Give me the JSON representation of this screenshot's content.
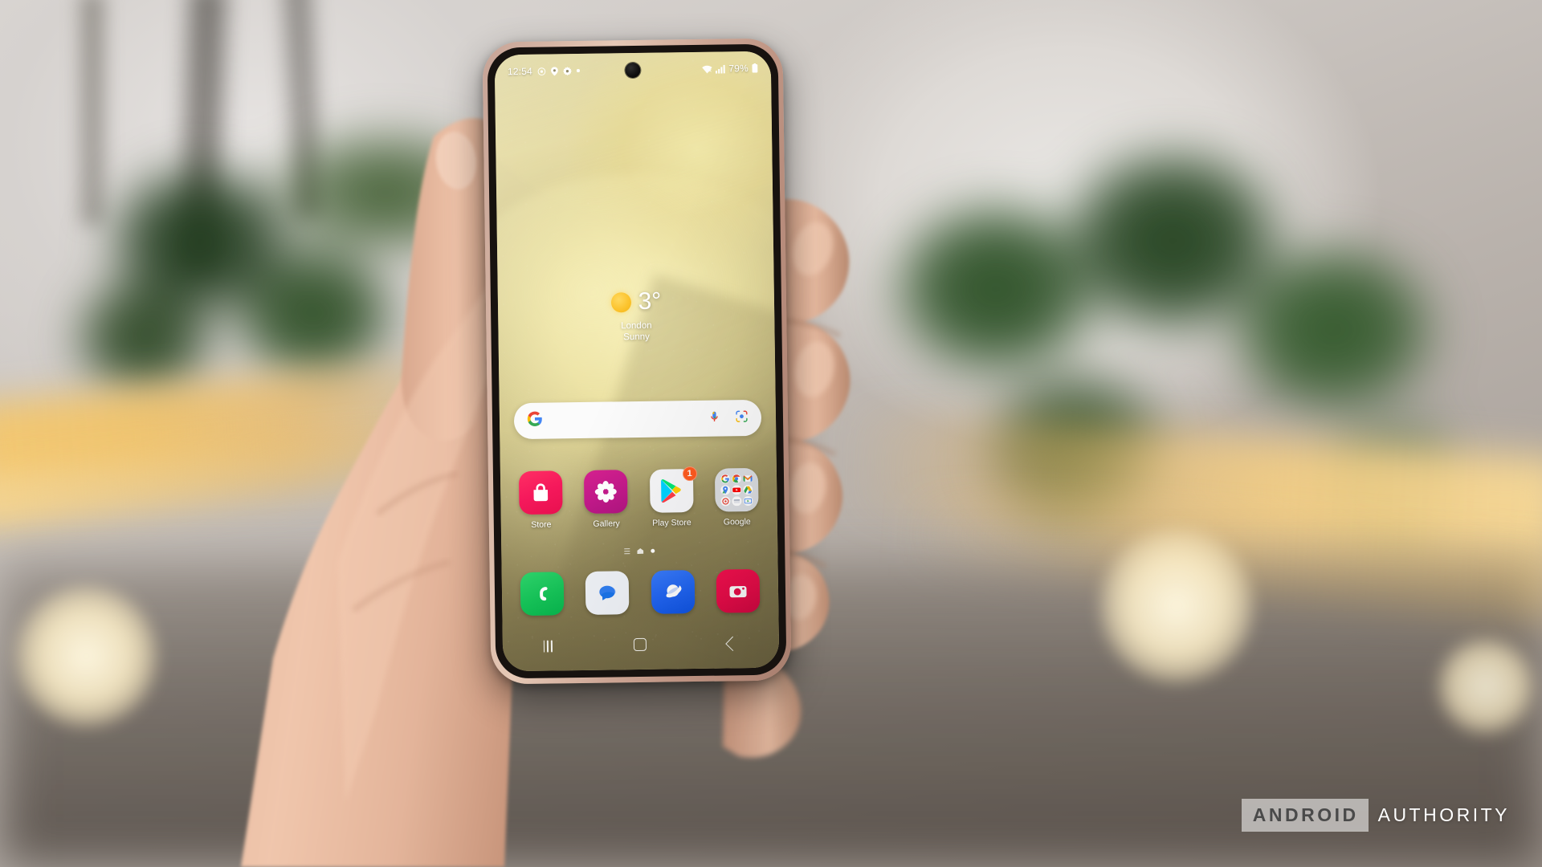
{
  "scene": {
    "watermark": {
      "brand": "ANDROID",
      "suffix": "AUTHORITY"
    }
  },
  "phone": {
    "status_bar": {
      "clock": "12:54",
      "left_icons": [
        "target-icon",
        "location-pin-icon",
        "settings-gear-icon",
        "dot-indicator"
      ],
      "right_icons": [
        "wifi-icon",
        "cellular-signal-icon"
      ],
      "battery_percent": "79%",
      "battery_icon": "battery-icon"
    },
    "weather_widget": {
      "temperature": "3°",
      "city": "London",
      "condition": "Sunny",
      "icon": "sun-icon"
    },
    "search_bar": {
      "logo": "google-g-icon",
      "placeholder": "",
      "value": "",
      "mic_icon": "microphone-icon",
      "lens_icon": "google-lens-icon"
    },
    "app_grid": [
      {
        "label": "Store",
        "icon": "galaxy-store-icon",
        "badge": ""
      },
      {
        "label": "Gallery",
        "icon": "gallery-icon",
        "badge": ""
      },
      {
        "label": "Play Store",
        "icon": "google-play-store-icon",
        "badge": "1"
      },
      {
        "label": "Google",
        "icon": "google-folder-icon",
        "badge": "",
        "folder_apps": [
          "google-search",
          "chrome",
          "gmail",
          "maps",
          "youtube",
          "drive",
          "google-one",
          "photos",
          "google-tv"
        ]
      }
    ],
    "page_indicator": {
      "pages": 3,
      "active_index": 2,
      "left_icon": "app-list-icon",
      "home_icon": "home-page-icon"
    },
    "dock": [
      {
        "label": "Phone",
        "icon": "phone-dialer-icon"
      },
      {
        "label": "Messages",
        "icon": "messages-icon"
      },
      {
        "label": "Internet",
        "icon": "samsung-internet-icon"
      },
      {
        "label": "Camera",
        "icon": "camera-icon"
      }
    ],
    "nav_bar": {
      "recents": "recents-button",
      "home": "home-button",
      "back": "back-button"
    }
  },
  "colors": {
    "accent_store": "#f5185b",
    "accent_gallery": "#c2198a",
    "accent_badge": "#ff5a1f",
    "accent_phone": "#15c157",
    "accent_browser": "#1f63f0",
    "accent_camera": "#e80c49",
    "sun": "#fcc42e"
  }
}
